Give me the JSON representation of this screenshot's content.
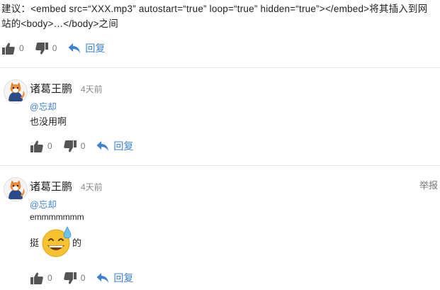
{
  "post": {
    "text": "建议：<embed src=“XXX.mp3” autostart=“true” loop=“true” hidden=“true”></embed>将其插入到网站的<body>…</body>之间",
    "likes": "0",
    "dislikes": "0",
    "reply_label": "回复"
  },
  "comments": [
    {
      "user": "诸葛王鹏",
      "time": "4天前",
      "mention": "@忘却",
      "text": "也没用啊",
      "likes": "0",
      "dislikes": "0",
      "reply_label": "回复"
    },
    {
      "user": "诸葛王鹏",
      "time": "4天前",
      "mention": "@忘却",
      "text": "emmmmmmm",
      "text2_before": "挺",
      "emoji": "sweat-smile-emoji",
      "text2_after": "的",
      "report_label": "举报",
      "likes": "0",
      "dislikes": "0",
      "reply_label": "回复"
    }
  ],
  "colors": {
    "link": "#3b82d6",
    "icon": "#555555",
    "divider": "#e8e8e8"
  },
  "icons": {
    "like": "thumbs-up-icon",
    "dislike": "thumbs-down-icon",
    "reply": "reply-arrow-icon",
    "avatar": "fox-avatar"
  }
}
